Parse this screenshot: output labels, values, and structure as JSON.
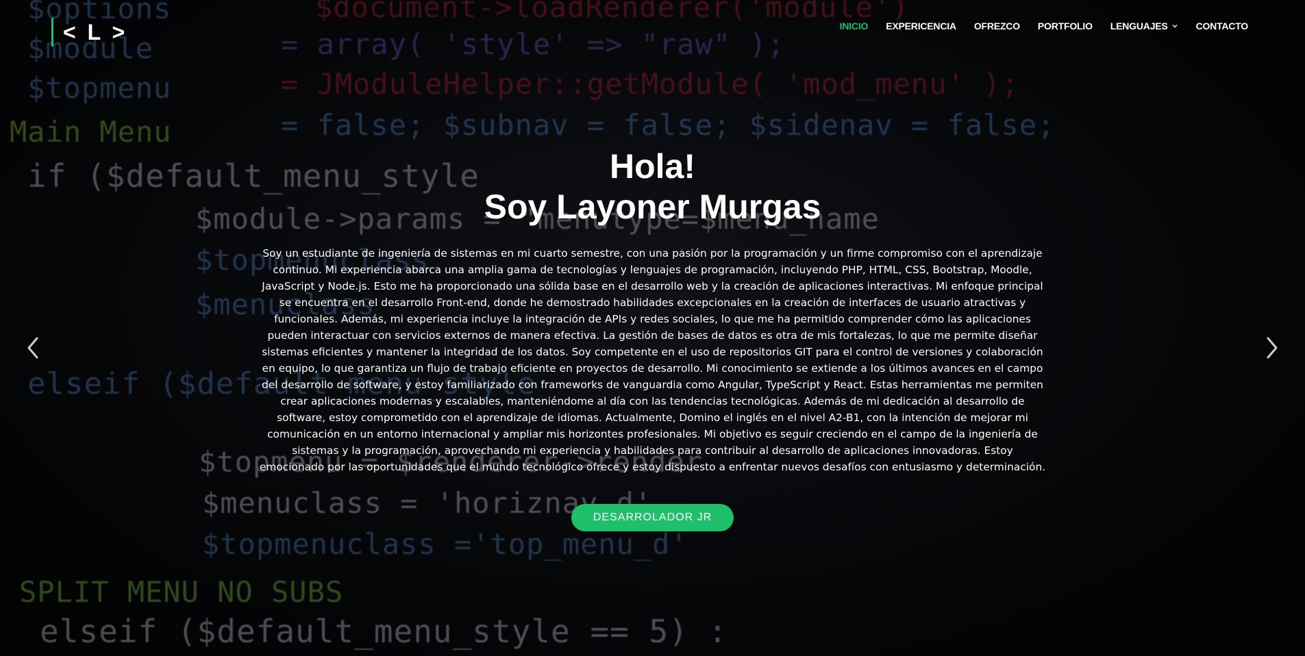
{
  "header": {
    "logo_text": "< L >",
    "nav": [
      {
        "label": "INICIO",
        "active": true
      },
      {
        "label": "EXPERICENCIA",
        "active": false
      },
      {
        "label": "OFREZCO",
        "active": false
      },
      {
        "label": "PORTFOLIO",
        "active": false
      },
      {
        "label": "LENGUAJES",
        "active": false,
        "has_dropdown": true
      },
      {
        "label": "CONTACTO",
        "active": false
      }
    ]
  },
  "hero": {
    "greeting": "Hola!",
    "name": "Soy Layoner Murgas",
    "description": "Soy un estudiante de ingeniería de sistemas en mi cuarto semestre, con una pasión por la programación y un firme compromiso con el aprendizaje continuo. Mi experiencia abarca una amplia gama de tecnologías y lenguajes de programación, incluyendo PHP, HTML, CSS, Bootstrap, Moodle, JavaScript y Node.js. Esto me ha proporcionado una sólida base en el desarrollo web y la creación de aplicaciones interactivas. Mi enfoque principal se encuentra en el desarrollo Front-end, donde he demostrado habilidades excepcionales en la creación de interfaces de usuario atractivas y funcionales. Además, mi experiencia incluye la integración de APIs y redes sociales, lo que me ha permitido comprender cómo las aplicaciones pueden interactuar con servicios externos de manera efectiva. La gestión de bases de datos es otra de mis fortalezas, lo que me permite diseñar sistemas eficientes y mantener la integridad de los datos. Soy competente en el uso de repositorios GIT para el control de versiones y colaboración en equipo, lo que garantiza un flujo de trabajo eficiente en proyectos de desarrollo. Mi conocimiento se extiende a los últimos avances en el campo del desarrollo de software, y estoy familiarizado con frameworks de vanguardia como Angular, TypeScript y React. Estas herramientas me permiten crear aplicaciones modernas y escalables, manteniéndome al día con las tendencias tecnológicas. Además de mi dedicación al desarrollo de software, estoy comprometido con el aprendizaje de idiomas. Actualmente, Domino el inglés en el nivel A2-B1, con la intención de mejorar mi comunicación en un entorno internacional y ampliar mis horizontes profesionales. Mi objetivo es seguir creciendo en el campo de la ingeniería de sistemas y la programación, aprovechando mi experiencia y habilidades para contribuir al desarrollo de aplicaciones innovadoras. Estoy emocionado por las oportunidades que el mundo tecnológico ofrece y estoy dispuesto a enfrentar nuevos desafíos con entusiasmo y determinación.",
    "cta_label": "DESARROLADOR JR"
  },
  "carousel": {
    "prev_icon": "chevron-left-icon",
    "next_icon": "chevron-right-icon"
  },
  "background_code": [
    "$options",
    "$module",
    "$topmenu",
    "Main Menu",
    "if ($default_menu_style",
    "$module->params = \"menutype=$menu_name",
    "$topmenuclass",
    "$menuclass",
    "elseif ($default_menu_style",
    "$topmenu = $renderer->render",
    "$menuclass = 'horiznav_d'",
    "$topmenuclass ='top_menu_d'",
    "SPLIT MENU  NO SUBS",
    "elseif ($default_menu_style == 5) :",
    "$document->loadRenderer('module')",
    "= array( 'style' => \"raw\" );",
    "= JModuleHelper::getModule( 'mod_menu' );",
    "= false; $subnav = false; $sidenav = false;"
  ],
  "colors": {
    "accent": "#1fbf6b",
    "text": "#ffffff",
    "background": "#0b0c10"
  }
}
